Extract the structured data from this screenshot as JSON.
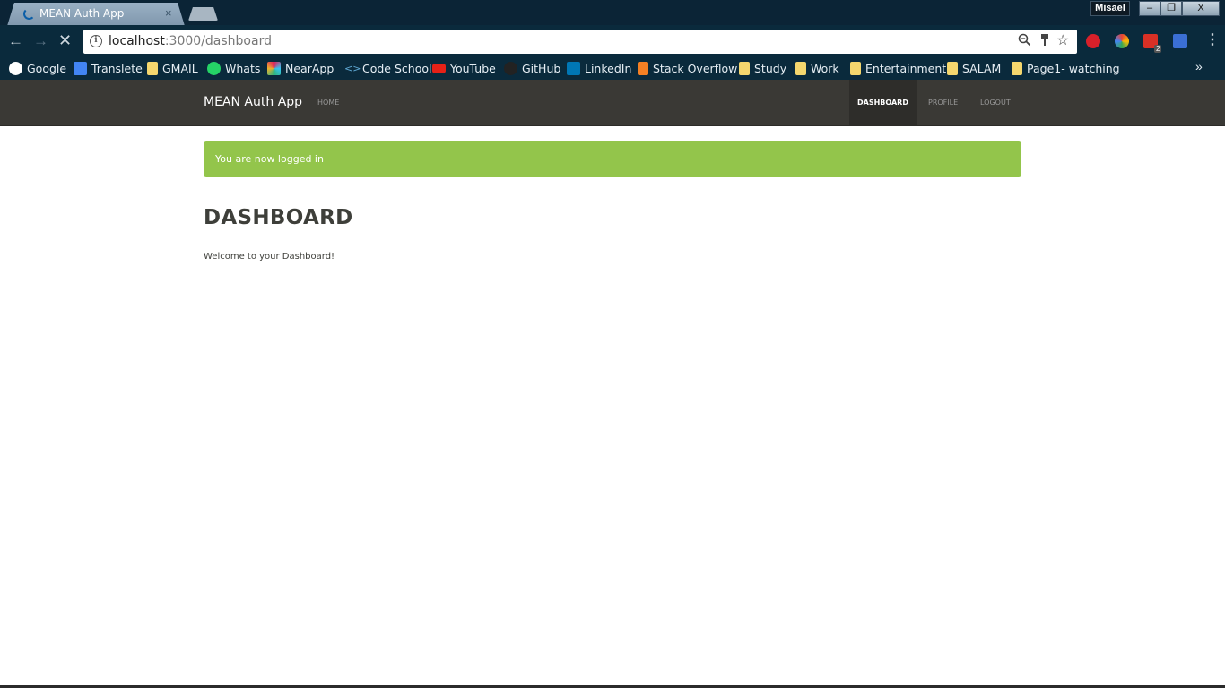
{
  "browser": {
    "tab_title": "MEAN Auth App",
    "tab_close": "×",
    "profile_name": "Misael",
    "window_buttons": {
      "minimize": "–",
      "restore": "❐",
      "close": "X"
    },
    "url_host": "localhost",
    "url_path": ":3000/dashboard",
    "extension_badge": "2",
    "bookmarks": [
      {
        "label": "Google",
        "icon": "google-icon",
        "color": "#ffffff"
      },
      {
        "label": "Translete",
        "icon": "translate-icon",
        "color": "#4285f4"
      },
      {
        "label": "GMAIL",
        "icon": "folder-icon",
        "color": "#f5d76e"
      },
      {
        "label": "Whats",
        "icon": "whatsapp-icon",
        "color": "#25d366"
      },
      {
        "label": "NearApp",
        "icon": "slack-icon",
        "color": "#e01e5a"
      },
      {
        "label": "Code School",
        "icon": "code-icon",
        "color": "#5fa8d3"
      },
      {
        "label": "YouTube",
        "icon": "youtube-icon",
        "color": "#e62117"
      },
      {
        "label": "GitHub",
        "icon": "github-icon",
        "color": "#222222"
      },
      {
        "label": "LinkedIn",
        "icon": "linkedin-icon",
        "color": "#0077b5"
      },
      {
        "label": "Stack Overflow",
        "icon": "stackoverflow-icon",
        "color": "#f48024"
      },
      {
        "label": "Study",
        "icon": "folder-icon",
        "color": "#f5d76e"
      },
      {
        "label": "Work",
        "icon": "folder-icon",
        "color": "#f5d76e"
      },
      {
        "label": "Entertainment",
        "icon": "folder-icon",
        "color": "#f5d76e"
      },
      {
        "label": "SALAM",
        "icon": "folder-icon",
        "color": "#f5d76e"
      },
      {
        "label": "Page1- watching",
        "icon": "folder-icon",
        "color": "#f5d76e"
      }
    ],
    "more_bookmarks": "»"
  },
  "app": {
    "brand": "MEAN Auth App",
    "nav_left": [
      {
        "label": "HOME"
      }
    ],
    "nav_right": [
      {
        "label": "DASHBOARD",
        "active": true
      },
      {
        "label": "PROFILE",
        "active": false
      },
      {
        "label": "LOGOUT",
        "active": false
      }
    ],
    "alert": {
      "text": "You are now logged in",
      "color": "#93c54b"
    },
    "page_title": "DASHBOARD",
    "welcome_text": "Welcome to your Dashboard!"
  },
  "colors": {
    "navbar_bg": "#3a3935",
    "chrome_bg": "#0a2a3c"
  }
}
